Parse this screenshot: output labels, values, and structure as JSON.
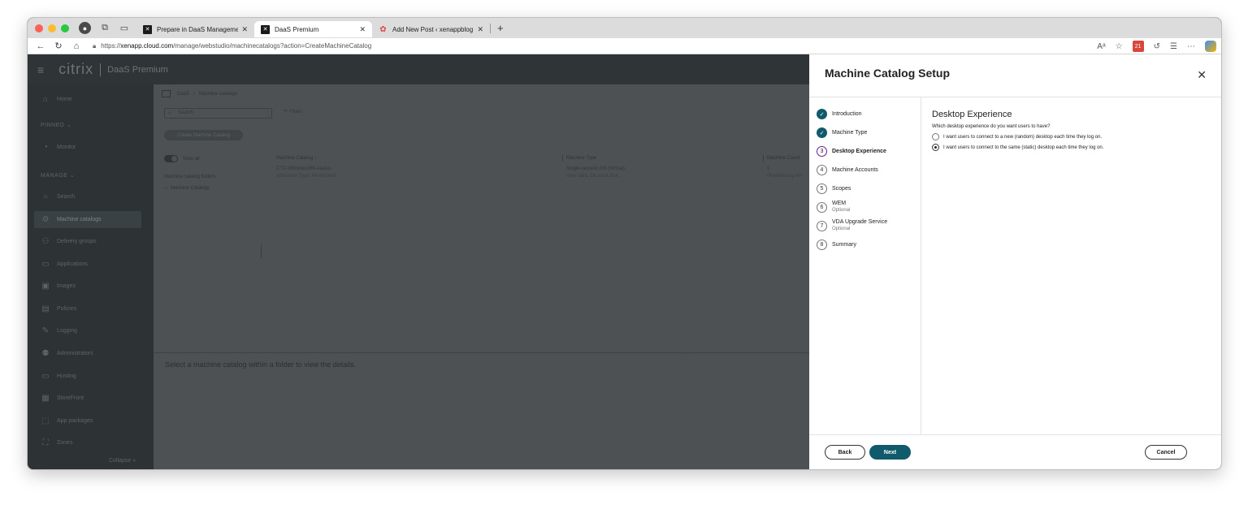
{
  "browser": {
    "tabs": [
      {
        "label": "Prepare in DaaS Management (",
        "active": false
      },
      {
        "label": "DaaS Premium",
        "active": true
      },
      {
        "label": "Add New Post ‹ xenappblog — ",
        "active": false
      }
    ],
    "url_prefix": "https://",
    "url_host": "xenapp.cloud.com",
    "url_path": "/manage/webstudio/machinecatalogs?action=CreateMachineCatalog",
    "ext_badge": "21"
  },
  "app": {
    "brand": "citrix",
    "product": "DaaS Premium",
    "sidebar": {
      "pinned_label": "PINNED",
      "manage_label": "MANAGE",
      "items": [
        {
          "label": "Home",
          "icon": "home-icon"
        },
        {
          "label": "Monitor",
          "icon": "monitor-icon"
        },
        {
          "label": "Search",
          "icon": "search-icon"
        },
        {
          "label": "Machine catalogs",
          "icon": "machine-catalogs-icon"
        },
        {
          "label": "Delivery groups",
          "icon": "delivery-groups-icon"
        },
        {
          "label": "Applications",
          "icon": "applications-icon"
        },
        {
          "label": "Images",
          "icon": "images-icon"
        },
        {
          "label": "Policies",
          "icon": "policies-icon"
        },
        {
          "label": "Logging",
          "icon": "logging-icon"
        },
        {
          "label": "Administrators",
          "icon": "administrators-icon"
        },
        {
          "label": "Hosting",
          "icon": "hosting-icon"
        },
        {
          "label": "StoreFront",
          "icon": "storefront-icon"
        },
        {
          "label": "App packages",
          "icon": "app-packages-icon"
        },
        {
          "label": "Zones",
          "icon": "zones-icon"
        }
      ],
      "collapse_label": "Collapse"
    },
    "breadcrumb": {
      "root": "DaaS",
      "current": "Machine catalogs"
    },
    "search_placeholder": "Search",
    "filters_label": "Filters",
    "create_button": "Create Machine Catalog",
    "view_all_label": "View all",
    "folders_label": "Machine catalog folders",
    "folder_item": "Machine Catalogs",
    "columns": [
      "Machine Catalog ↓",
      "Machine Type",
      "Machine Count"
    ],
    "row": {
      "name": "CTX-Windows365-eastus",
      "name_sub": "Allocation Type: Permanent",
      "type": "Single-session OS (Virtual)",
      "type_sub": "User data: On local disk",
      "count": "1",
      "count_sub": "Provisioning me"
    },
    "detail_message": "Select a machine catalog within a folder to view the details."
  },
  "panel": {
    "title": "Machine Catalog Setup",
    "steps": [
      {
        "num": "1",
        "label": "Introduction",
        "state": "done",
        "optional": ""
      },
      {
        "num": "2",
        "label": "Machine Type",
        "state": "done",
        "optional": ""
      },
      {
        "num": "3",
        "label": "Desktop Experience",
        "state": "current",
        "optional": ""
      },
      {
        "num": "4",
        "label": "Machine Accounts",
        "state": "todo",
        "optional": ""
      },
      {
        "num": "5",
        "label": "Scopes",
        "state": "todo",
        "optional": ""
      },
      {
        "num": "6",
        "label": "WEM",
        "state": "todo",
        "optional": "Optional"
      },
      {
        "num": "7",
        "label": "VDA Upgrade Service",
        "state": "todo",
        "optional": "Optional"
      },
      {
        "num": "8",
        "label": "Summary",
        "state": "todo",
        "optional": ""
      }
    ],
    "heading": "Desktop Experience",
    "question": "Which desktop experience do you want users to have?",
    "options": [
      {
        "label": "I want users to connect to a new (random) desktop each time they log on.",
        "selected": false
      },
      {
        "label": "I want users to connect to the same (static) desktop each time they log on.",
        "selected": true
      }
    ],
    "back_label": "Back",
    "next_label": "Next",
    "cancel_label": "Cancel"
  },
  "colors": {
    "accent": "#0f5b6b",
    "current_step": "#6a1b9a"
  }
}
